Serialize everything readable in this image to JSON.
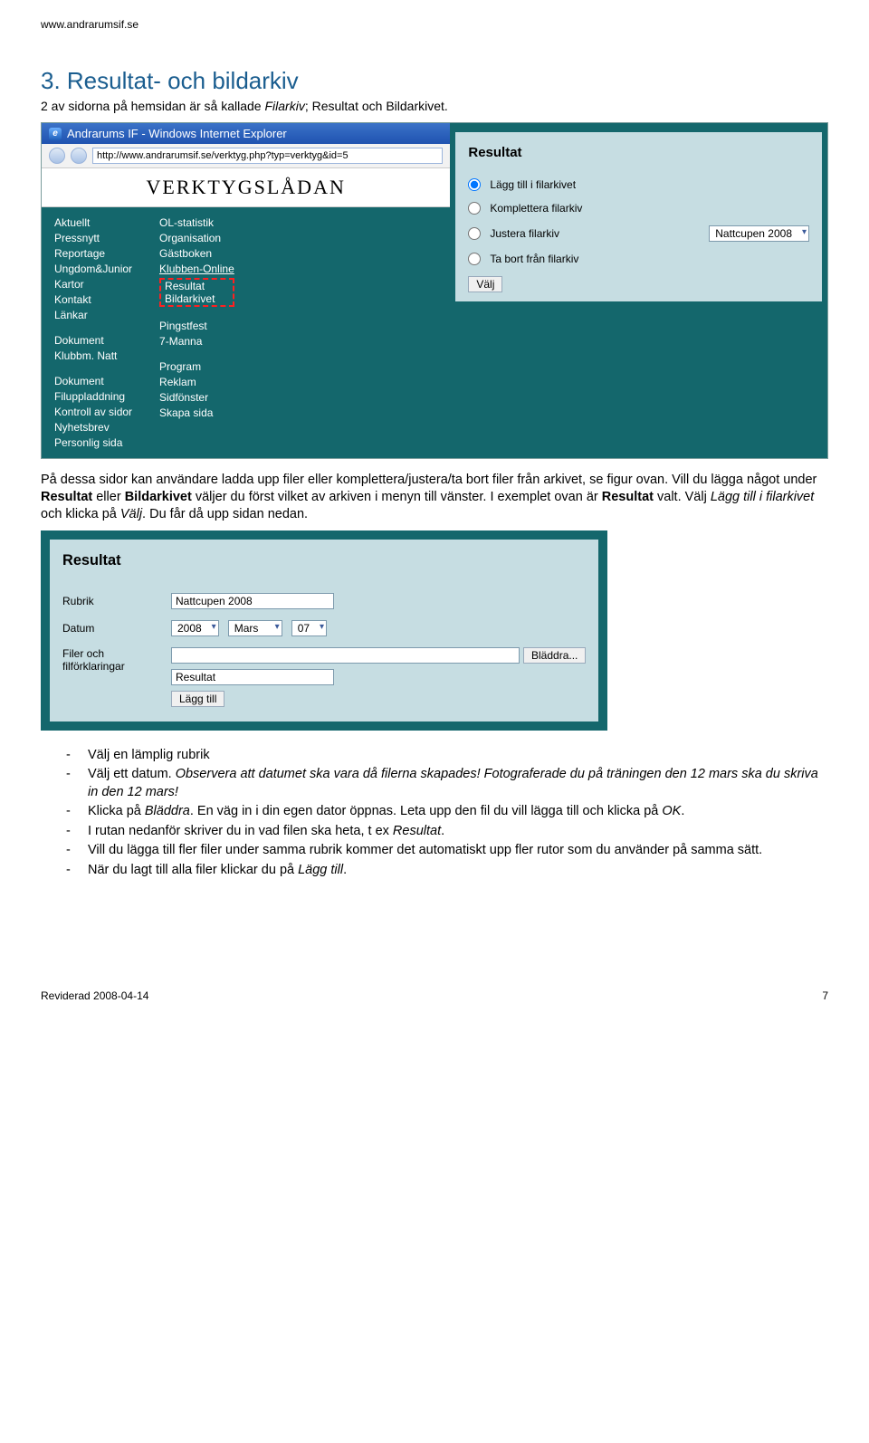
{
  "header_url": "www.andrarumsif.se",
  "section": {
    "title": "3. Resultat- och bildarkiv",
    "intro_pre": "2 av sidorna på hemsidan är så kallade ",
    "intro_em": "Filarkiv",
    "intro_post": "; Resultat och Bildarkivet."
  },
  "ie": {
    "title": "Andrarums IF - Windows Internet Explorer",
    "url": "http://www.andrarumsif.se/verktyg.php?typ=verktyg&id=5"
  },
  "logo": "VERKTYGSLÅDAN",
  "nav_left": [
    "Aktuellt",
    "Pressnytt",
    "Reportage",
    "Ungdom&Junior",
    "Kartor",
    "Kontakt",
    "Länkar",
    "",
    "Dokument",
    "Klubbm. Natt",
    "",
    "Dokument",
    "Filuppladdning",
    "Kontroll av sidor",
    "Nyhetsbrev",
    "Personlig sida"
  ],
  "nav_right": [
    "OL-statistik",
    "Organisation",
    "Gästboken",
    "Klubben-Online",
    "Resultat",
    "Bildarkivet",
    "",
    "",
    "Pingstfest",
    "7-Manna",
    "",
    "Program",
    "Reklam",
    "Sidfönster",
    "Skapa sida"
  ],
  "panel1": {
    "title": "Resultat",
    "opt1": "Lägg till i filarkivet",
    "opt2": "Komplettera filarkiv",
    "opt3": "Justera filarkiv",
    "opt4": "Ta bort från filarkiv",
    "select": "Nattcupen 2008",
    "btn": "Välj"
  },
  "mid": {
    "p1_a": "På dessa sidor kan användare ladda upp filer eller komplettera/justera/ta bort filer från arkivet, se figur ovan. Vill du lägga något under ",
    "p1_b1": "Resultat",
    "p1_c": " eller ",
    "p1_b2": "Bildarkivet",
    "p1_d": " väljer du först vilket av arkiven i menyn till vänster. I exemplet ovan är ",
    "p1_b3": "Resultat",
    "p1_e": " valt. Välj ",
    "p1_em": "Lägg till i filarkivet",
    "p1_f": " och klicka på ",
    "p1_em2": "Välj",
    "p1_g": ". Du får då upp sidan nedan."
  },
  "panel2": {
    "title": "Resultat",
    "l_rubrik": "Rubrik",
    "v_rubrik": "Nattcupen 2008",
    "l_datum": "Datum",
    "v_year": "2008",
    "v_month": "Mars",
    "v_day": "07",
    "l_filer": "Filer och filförklaringar",
    "v_desc": "Resultat",
    "btn_browse": "Bläddra...",
    "btn_add": "Lägg till"
  },
  "bullets": {
    "b1": "Välj en lämplig rubrik",
    "b2_a": "Välj ett datum. ",
    "b2_b": "Observera att datumet ska vara då filerna skapades! Fotograferade du på träningen den 12 mars ska du skriva in den 12 mars!",
    "b3_a": "Klicka på ",
    "b3_b": "Bläddra",
    "b3_c": ". En väg in i din egen dator öppnas. Leta upp den fil du vill lägga till och klicka på ",
    "b3_d": "OK",
    "b3_e": ".",
    "b4_a": "I rutan nedanför skriver du in vad filen ska heta, t ex ",
    "b4_b": "Resultat",
    "b4_c": ".",
    "b5": "Vill du lägga till fler filer under samma rubrik kommer det automatiskt upp fler rutor som du använder på samma sätt.",
    "b6_a": "När du lagt till alla filer klickar du på ",
    "b6_b": "Lägg till",
    "b6_c": "."
  },
  "footer": {
    "left": "Reviderad 2008-04-14",
    "right": "7"
  }
}
